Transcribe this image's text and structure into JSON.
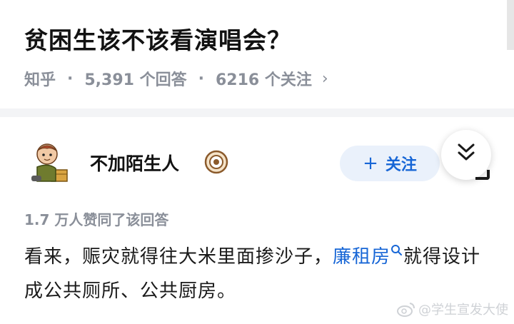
{
  "question": {
    "title": "贫困生该不该看演唱会？",
    "source": "知乎",
    "answer_count": "5,391 个回答",
    "follower_count": "6216 个关注",
    "chevron": "›"
  },
  "author": {
    "name": "不加陌生人",
    "avatar_icon": "cartoon-avatar-icon",
    "badge_icon": "verified-badge-icon",
    "follow_label": "关注",
    "follow_plus": "+",
    "collapse_icon": "double-chevron-down-icon"
  },
  "answer": {
    "likes": "1.7 万人赞同了该回答",
    "text_before": "看来，赈灾就得往大米里面掺沙子，",
    "link_text": "廉租房",
    "text_after": "就得设计成公共厕所、公共厨房。"
  },
  "watermark": {
    "text": "@学生宣发大使"
  },
  "colors": {
    "link": "#1766d6",
    "meta_gray": "#8a8f99",
    "follow_bg": "#eaf1fb",
    "separator": "#f3f4f6"
  }
}
